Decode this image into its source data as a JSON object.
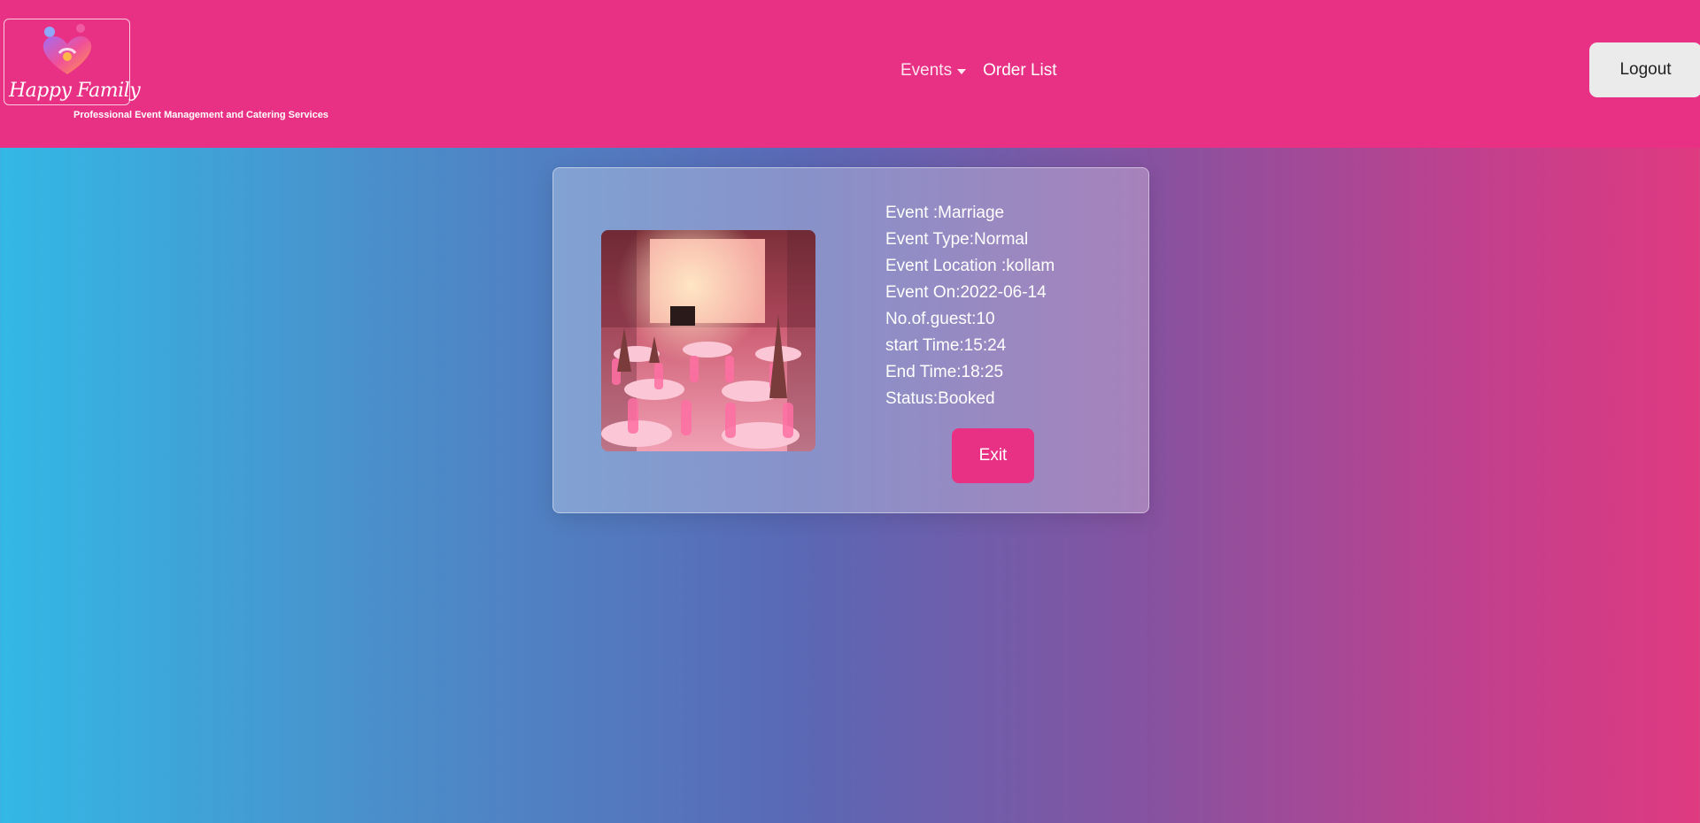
{
  "brand": {
    "name": "Happy Family",
    "tagline": "Professional Event Management and Catering Services",
    "logo_icon": "heart-family-icon"
  },
  "nav": {
    "items": [
      {
        "label": "Events",
        "has_dropdown": true
      },
      {
        "label": "Order List",
        "has_dropdown": false
      }
    ]
  },
  "header": {
    "logout_label": "Logout"
  },
  "event": {
    "image_icon": "wedding-hall-photo",
    "details": [
      "Event :Marriage",
      "Event Type:Normal",
      "Event Location :kollam",
      "Event On:2022-06-14",
      "No.of.guest:10",
      "start Time:15:24",
      "End Time:18:25",
      "Status:Booked"
    ],
    "exit_label": "Exit"
  },
  "colors": {
    "navbar": "#e83184",
    "accent": "#e83184",
    "gradient_start": "#33b8e5",
    "gradient_end": "#df3a80"
  }
}
